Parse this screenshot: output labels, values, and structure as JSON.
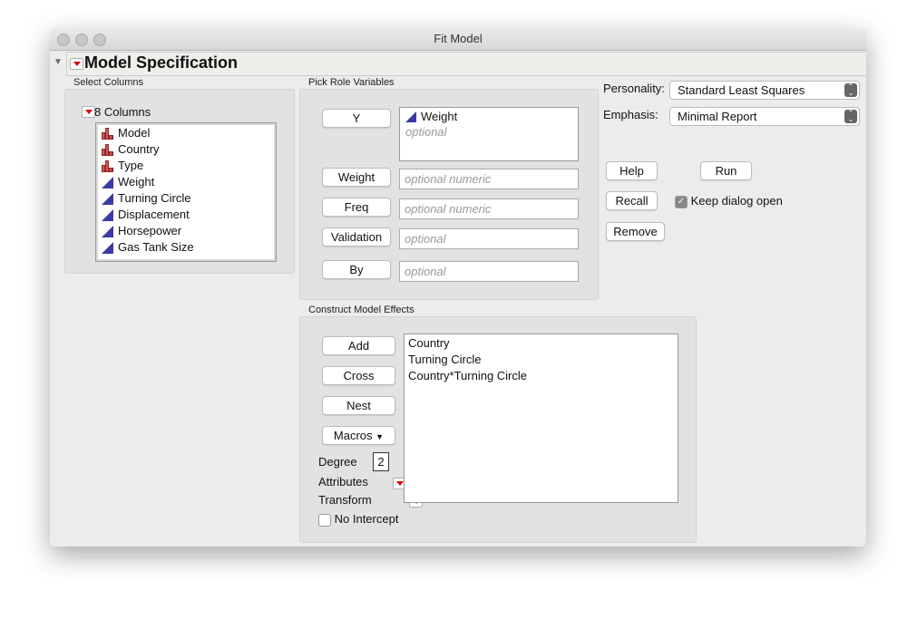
{
  "window": {
    "title": "Fit Model"
  },
  "header": {
    "title": "Model Specification"
  },
  "select_columns": {
    "label": "Select Columns",
    "count_label": "8 Columns",
    "columns": [
      {
        "name": "Model",
        "type": "nominal"
      },
      {
        "name": "Country",
        "type": "nominal"
      },
      {
        "name": "Type",
        "type": "nominal"
      },
      {
        "name": "Weight",
        "type": "continuous"
      },
      {
        "name": "Turning Circle",
        "type": "continuous"
      },
      {
        "name": "Displacement",
        "type": "continuous"
      },
      {
        "name": "Horsepower",
        "type": "continuous"
      },
      {
        "name": "Gas Tank Size",
        "type": "continuous"
      }
    ]
  },
  "roles": {
    "label": "Pick Role Variables",
    "y": {
      "button": "Y",
      "value": "Weight",
      "placeholder": "optional"
    },
    "weight": {
      "button": "Weight",
      "placeholder": "optional numeric"
    },
    "freq": {
      "button": "Freq",
      "placeholder": "optional numeric"
    },
    "validation": {
      "button": "Validation",
      "placeholder": "optional"
    },
    "by": {
      "button": "By",
      "placeholder": "optional"
    }
  },
  "options": {
    "personality_label": "Personality:",
    "personality": "Standard Least Squares",
    "emphasis_label": "Emphasis:",
    "emphasis": "Minimal Report",
    "help": "Help",
    "run": "Run",
    "recall": "Recall",
    "keep_open": "Keep dialog open",
    "keep_open_checked": true,
    "remove": "Remove"
  },
  "effects": {
    "label": "Construct Model Effects",
    "add": "Add",
    "cross": "Cross",
    "nest": "Nest",
    "macros": "Macros",
    "degree_label": "Degree",
    "degree": "2",
    "attributes": "Attributes",
    "transform": "Transform",
    "no_intercept": "No Intercept",
    "no_intercept_checked": false,
    "items": [
      "Country",
      "Turning Circle",
      "Country*Turning Circle"
    ]
  }
}
